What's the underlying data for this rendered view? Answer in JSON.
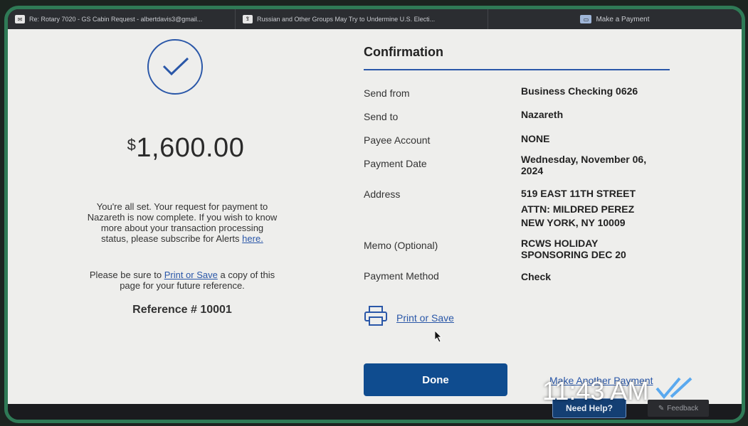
{
  "tabs": [
    {
      "label": "Re: Rotary 7020 - GS Cabin Request - albertdavis3@gmail...",
      "icon": "mail-icon"
    },
    {
      "label": "Russian and Other Groups May Try to Undermine U.S. Electi...",
      "icon": "nyt-icon"
    },
    {
      "label": "Make a Payment",
      "icon": "bank-icon"
    }
  ],
  "left": {
    "amount_symbol": "$",
    "amount": "1,600.00",
    "note_text": "You're all set. Your request for payment to Nazareth is now complete. If you wish to know more about your transaction processing status, please subscribe for Alerts",
    "note_link": "here.",
    "note2_before": "Please be sure to",
    "note2_link": "Print or Save",
    "note2_after": "a copy of this page for your future reference.",
    "reference": "Reference # 10001"
  },
  "confirmation": {
    "title": "Confirmation",
    "rows": [
      {
        "label": "Send from",
        "value": "Business Checking 0626"
      },
      {
        "label": "Send to",
        "value": "Nazareth"
      },
      {
        "label": "Payee Account",
        "value": "NONE"
      },
      {
        "label": "Payment Date",
        "value": "Wednesday, November 06, 2024"
      },
      {
        "label": "Address",
        "value_lines": [
          "519 EAST 11TH STREET",
          "ATTN: MILDRED PEREZ",
          "NEW YORK, NY 10009"
        ]
      },
      {
        "label": "Memo (Optional)",
        "value": "RCWS HOLIDAY SPONSORING DEC 20"
      },
      {
        "label": "Payment Method",
        "value": "Check"
      }
    ],
    "print_label": "Print or Save",
    "done_label": "Done",
    "another_label": "Make Another Payment"
  },
  "footer": {
    "need_help": "Need Help?",
    "feedback": "Feedback"
  },
  "overlay": {
    "time": "11:43 AM"
  },
  "colors": {
    "accent": "#2a57a8",
    "done_button": "#0f4c8f",
    "frame": "#2f7a56"
  }
}
